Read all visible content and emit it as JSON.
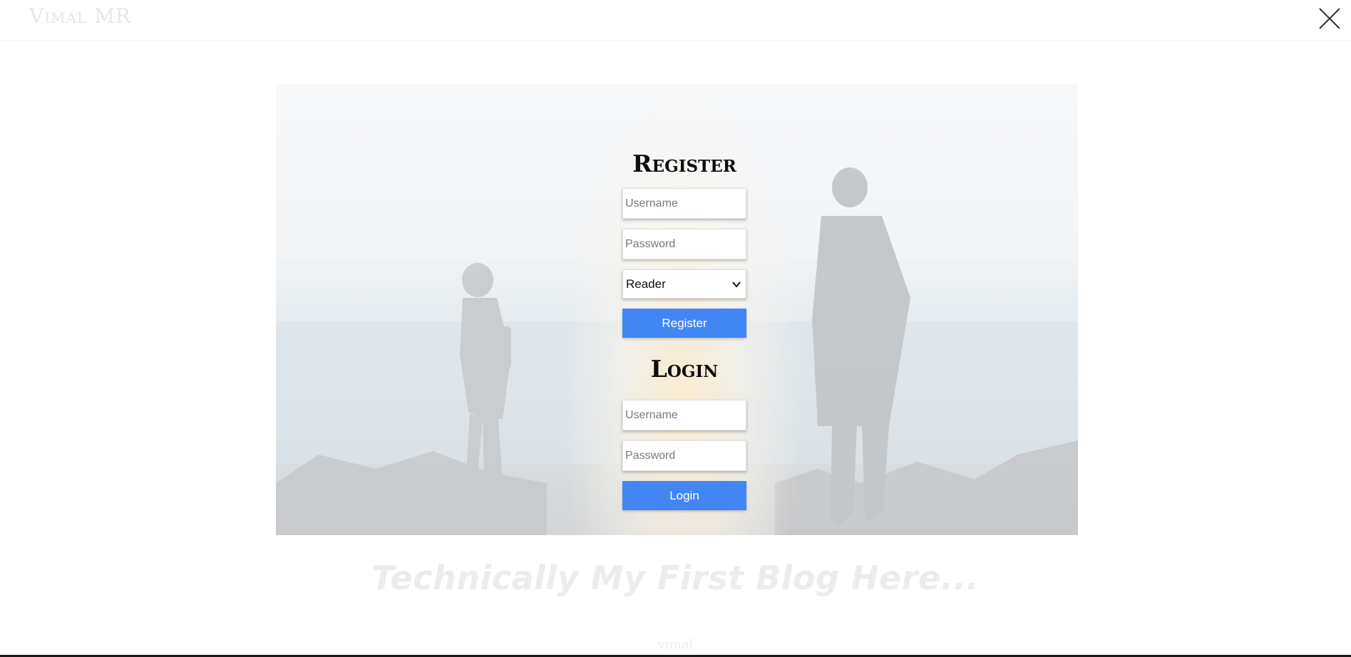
{
  "header": {
    "logo": "Vimal MR"
  },
  "register": {
    "title": "Register",
    "username_placeholder": "Username",
    "password_placeholder": "Password",
    "role_selected": "Reader",
    "submit_label": "Register"
  },
  "login": {
    "title": "Login",
    "username_placeholder": "Username",
    "password_placeholder": "Password",
    "submit_label": "Login"
  },
  "tagline": "Technically My First Blog Here...",
  "footer": {
    "mark": "vimal"
  },
  "colors": {
    "accent_button": "#4286f4",
    "title_text": "#0d0d0d"
  },
  "icons": {
    "close": "close-icon",
    "select_arrow": "chevron-down-icon"
  }
}
